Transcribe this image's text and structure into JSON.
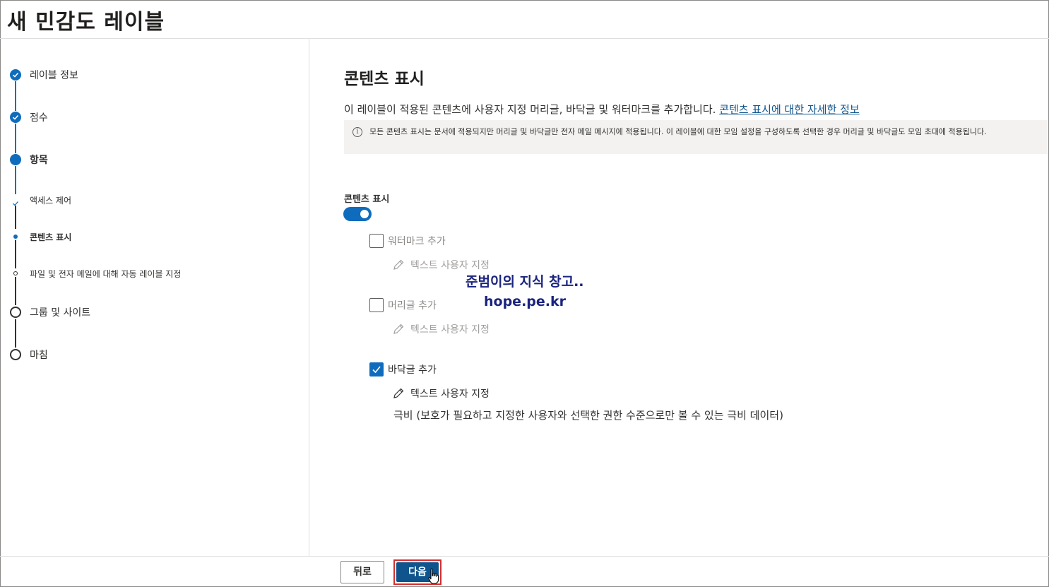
{
  "header": {
    "title": "새 민감도 레이블"
  },
  "sidebar": {
    "steps": [
      {
        "label": "레이블 정보",
        "state": "done"
      },
      {
        "label": "점수",
        "state": "done"
      },
      {
        "label": "항목",
        "state": "current"
      },
      {
        "label": "액세스 제어",
        "state": "sub-done"
      },
      {
        "label": "콘텐츠 표시",
        "state": "sub-current"
      },
      {
        "label": "파일 및 전자 메일에 대해 자동 레이블 지정",
        "state": "sub-pending"
      },
      {
        "label": "그룹 및 사이트",
        "state": "pending"
      },
      {
        "label": "마침",
        "state": "pending"
      }
    ]
  },
  "main": {
    "title": "콘텐츠 표시",
    "description": "이 레이블이 적용된 콘텐츠에 사용자 지정 머리글, 바닥글 및 워터마크를 추가합니다. ",
    "learn_more_link": "콘텐츠 표시에 대한 자세한 정보",
    "info_text": "모든 콘텐츠 표시는 문서에 적용되지만 머리글 및 바닥글만 전자 메일 메시지에 적용됩니다. 이 레이블에 대한 모임 설정을 구성하도록 선택한 경우 머리글 및 바닥글도 모임 초대에 적용됩니다.",
    "toggle_label": "콘텐츠 표시",
    "toggle_on": true,
    "options": [
      {
        "label": "워터마크 추가",
        "checked": false,
        "edit_label": "텍스트 사용자 지정"
      },
      {
        "label": "머리글 추가",
        "checked": false,
        "edit_label": "텍스트 사용자 지정"
      },
      {
        "label": "바닥글 추가",
        "checked": true,
        "edit_label": "텍스트 사용자 지정"
      }
    ],
    "footer_text": "극비 (보호가 필요하고 지정한 사용자와 선택한 권한 수준으로만 볼 수 있는 극비 데이터)"
  },
  "watermark": {
    "line1": "준범이의 지식 창고..",
    "line2": "hope.pe.kr"
  },
  "buttons": {
    "back": "뒤로",
    "next": "다음"
  },
  "colors": {
    "accent": "#0f6cbd",
    "primary_button": "#0f548c",
    "highlight_border": "#d32f2f"
  }
}
